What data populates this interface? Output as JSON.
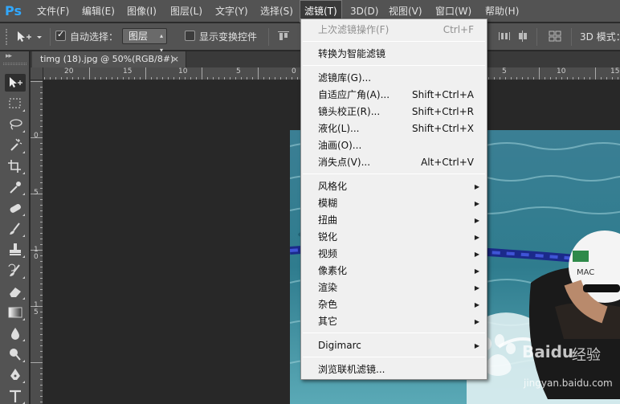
{
  "app": {
    "logo": "Ps"
  },
  "menubar": {
    "items": [
      "文件(F)",
      "编辑(E)",
      "图像(I)",
      "图层(L)",
      "文字(Y)",
      "选择(S)",
      "滤镜(T)",
      "3D(D)",
      "视图(V)",
      "窗口(W)",
      "帮助(H)"
    ],
    "active_index": 6
  },
  "options": {
    "auto_select_label": "自动选择：",
    "auto_select_checked": true,
    "target_value": "图层",
    "show_transform_label": "显示变换控件",
    "show_transform_checked": false,
    "mode_label": "3D 模式："
  },
  "document": {
    "tab_title": "timg (18).jpg @ 50%(RGB/8#)",
    "close_glyph": "×"
  },
  "rulers": {
    "horizontal": [
      "20",
      "15",
      "10",
      "5",
      "0",
      "5",
      "10",
      "15"
    ],
    "vertical": [
      "0",
      "5",
      "10",
      "15"
    ]
  },
  "filter_menu": {
    "items": [
      {
        "label": "上次滤镜操作(F)",
        "shortcut": "Ctrl+F",
        "disabled": true
      },
      {
        "label": "转换为智能滤镜"
      },
      {
        "label": "滤镜库(G)..."
      },
      {
        "label": "自适应广角(A)...",
        "shortcut": "Shift+Ctrl+A"
      },
      {
        "label": "镜头校正(R)...",
        "shortcut": "Shift+Ctrl+R"
      },
      {
        "label": "液化(L)...",
        "shortcut": "Shift+Ctrl+X"
      },
      {
        "label": "油画(O)..."
      },
      {
        "label": "消失点(V)...",
        "shortcut": "Alt+Ctrl+V"
      },
      {
        "label": "风格化",
        "submenu": true
      },
      {
        "label": "模糊",
        "submenu": true
      },
      {
        "label": "扭曲",
        "submenu": true
      },
      {
        "label": "锐化",
        "submenu": true
      },
      {
        "label": "视频",
        "submenu": true
      },
      {
        "label": "像素化",
        "submenu": true
      },
      {
        "label": "渲染",
        "submenu": true
      },
      {
        "label": "杂色",
        "submenu": true
      },
      {
        "label": "其它",
        "submenu": true
      },
      {
        "label": "Digimarc",
        "submenu": true
      },
      {
        "label": "浏览联机滤镜..."
      }
    ]
  },
  "watermark": {
    "brand": "Baidu",
    "product": "经验",
    "url": "jingyan.baidu.com"
  },
  "photo_text": {
    "cap_text": "MAC"
  }
}
